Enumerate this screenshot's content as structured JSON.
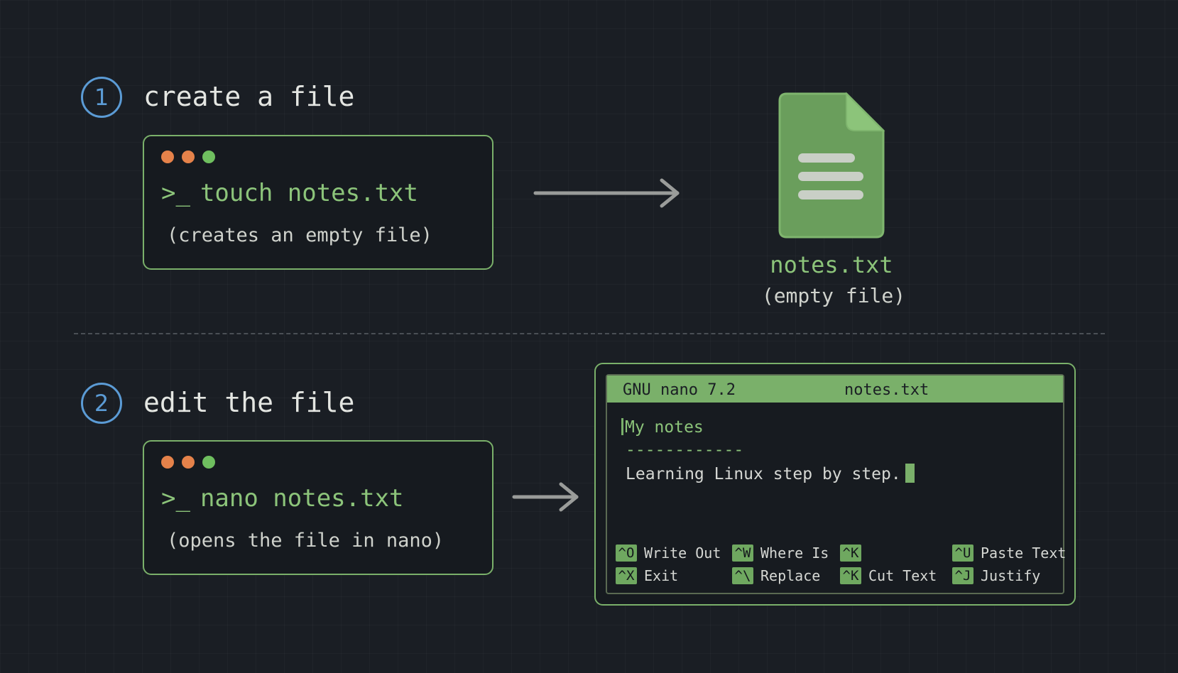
{
  "step1": {
    "number": "1",
    "title": "create a file",
    "prompt": ">_",
    "command": "touch notes.txt",
    "note": "(creates an empty file)"
  },
  "file": {
    "name": "notes.txt",
    "caption": "(empty file)"
  },
  "step2": {
    "number": "2",
    "title": "edit the file",
    "prompt": ">_",
    "command": "nano notes.txt",
    "note": "(opens the file in nano)"
  },
  "nano": {
    "title_left": "GNU nano 7.2",
    "title_center": "notes.txt",
    "lines": [
      "My notes",
      "------------",
      "Learning Linux step by step."
    ],
    "shortcuts": [
      {
        "key": "^O",
        "label": "Write Out"
      },
      {
        "key": "^W",
        "label": "Where Is"
      },
      {
        "key": "^K",
        "label": ""
      },
      {
        "key": "^U",
        "label": "Paste Text"
      },
      {
        "key": "^X",
        "label": "Exit"
      },
      {
        "key": "^\\",
        "label": "Replace"
      },
      {
        "key": "^K",
        "label": "Cut Text"
      },
      {
        "key": "^J",
        "label": "Justify"
      }
    ]
  },
  "colors": {
    "accent_green": "#7ab06a",
    "step_blue": "#5b9bd5",
    "dot_orange": "#e5824a"
  }
}
